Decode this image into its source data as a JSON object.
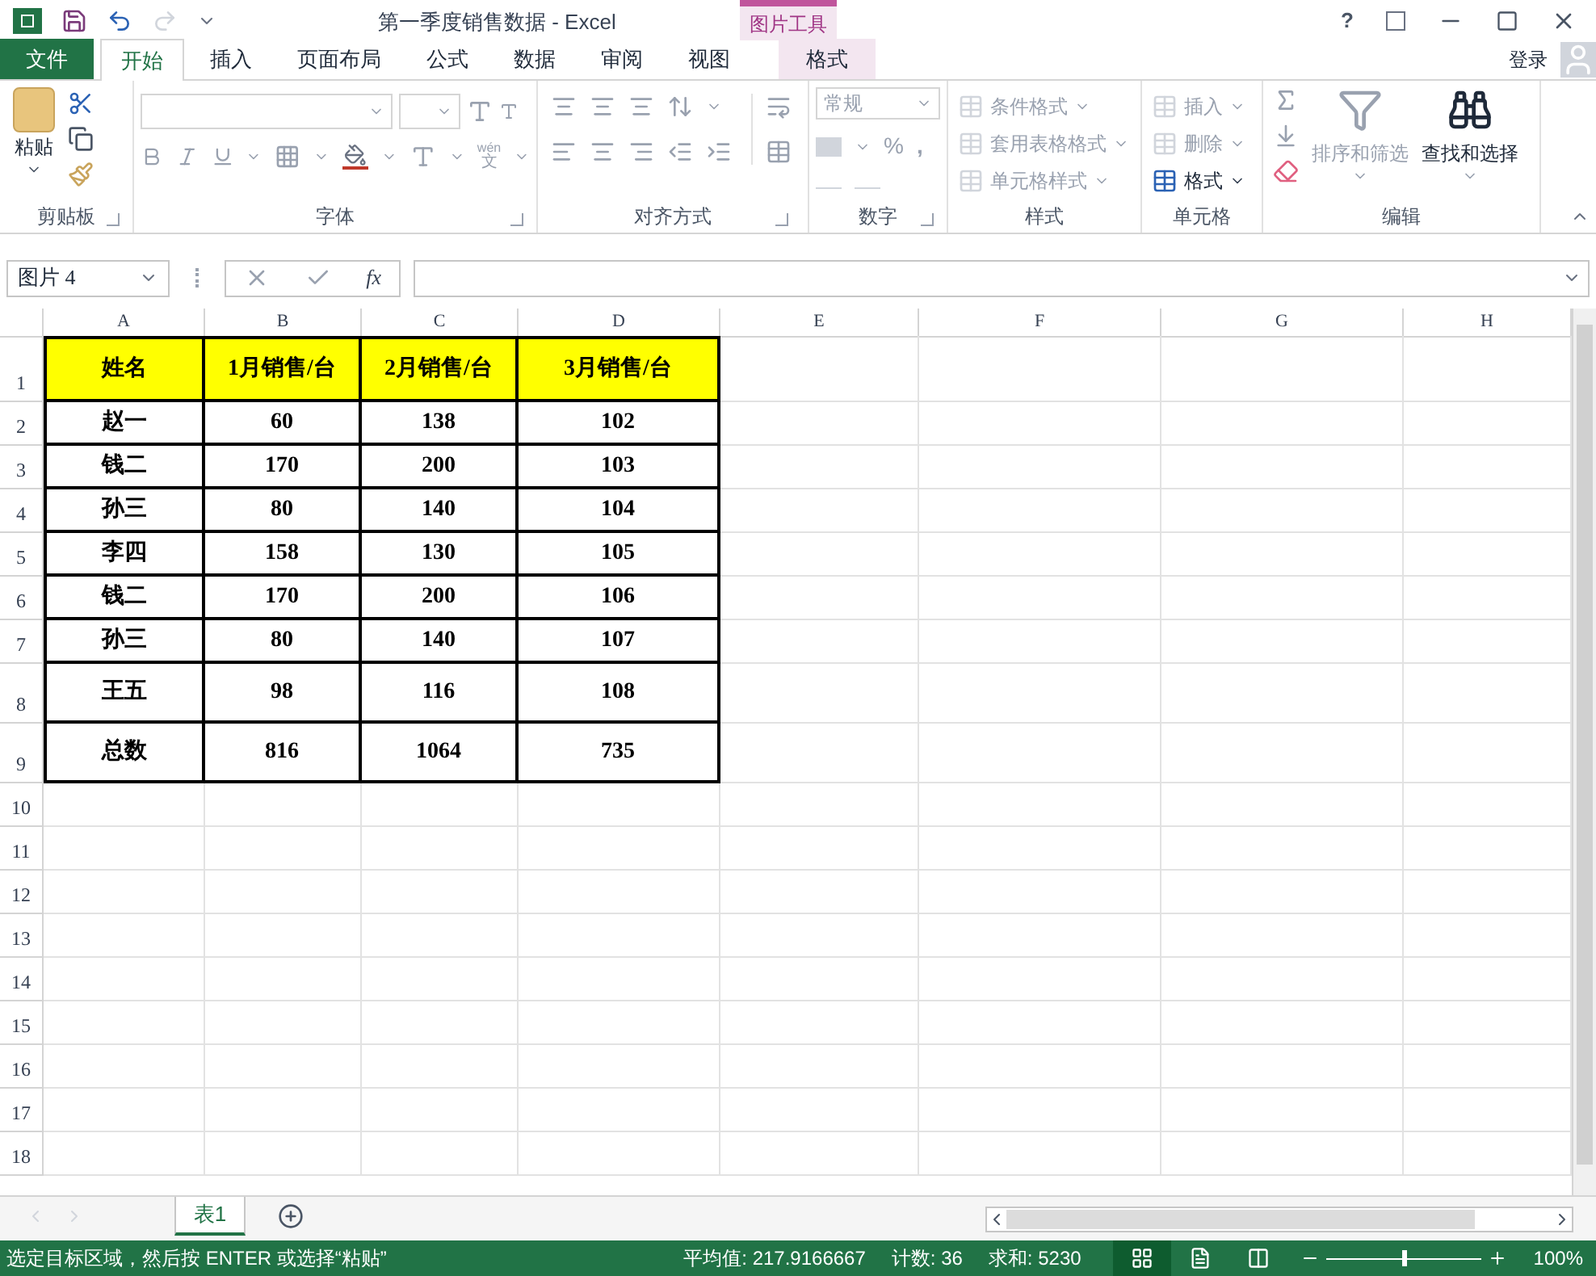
{
  "window": {
    "title": "第一季度销售数据 - Excel",
    "context_group": "图片工具",
    "help": "?",
    "account": "登录"
  },
  "ribbon_tabs": [
    {
      "label": "文件",
      "kind": "file",
      "selected": false
    },
    {
      "label": "开始",
      "kind": "normal",
      "selected": true
    },
    {
      "label": "插入",
      "kind": "normal",
      "selected": false
    },
    {
      "label": "页面布局",
      "kind": "normal",
      "selected": false
    },
    {
      "label": "公式",
      "kind": "normal",
      "selected": false
    },
    {
      "label": "数据",
      "kind": "normal",
      "selected": false
    },
    {
      "label": "审阅",
      "kind": "normal",
      "selected": false
    },
    {
      "label": "视图",
      "kind": "normal",
      "selected": false
    },
    {
      "label": "格式",
      "kind": "context",
      "selected": false
    }
  ],
  "ribbon": {
    "clipboard": {
      "paste": "粘贴",
      "label": "剪贴板"
    },
    "font": {
      "label": "字体",
      "phonetic_top": "wén",
      "phonetic_bottom": "文"
    },
    "alignment": {
      "label": "对齐方式"
    },
    "number": {
      "format": "常规",
      "percent": "%",
      "comma": ",",
      "label": "数字"
    },
    "styles": {
      "items": [
        {
          "label": "条件格式",
          "disabled": true
        },
        {
          "label": "套用表格格式",
          "disabled": true
        },
        {
          "label": "单元格样式",
          "disabled": true
        }
      ],
      "label": "样式"
    },
    "cells": {
      "items": [
        {
          "label": "插入",
          "disabled": true
        },
        {
          "label": "删除",
          "disabled": true
        },
        {
          "label": "格式",
          "disabled": false
        }
      ],
      "label": "单元格"
    },
    "editing": {
      "sort": {
        "label": "排序和筛选",
        "disabled": true
      },
      "find": {
        "label": "查找和选择",
        "disabled": false
      },
      "label": "编辑"
    }
  },
  "formula_bar": {
    "name_box": "图片 4",
    "fx": "fx"
  },
  "sheet": {
    "columns": [
      "A",
      "B",
      "C",
      "D",
      "E",
      "F",
      "G",
      "H"
    ],
    "rows": [
      {
        "number": "1",
        "kind": "header",
        "cells": [
          "姓名",
          "1月销售/台",
          "2月销售/台",
          "3月销售/台"
        ]
      },
      {
        "number": "2",
        "kind": "data",
        "cells": [
          "赵一",
          "60",
          "138",
          "102"
        ]
      },
      {
        "number": "3",
        "kind": "data",
        "cells": [
          "钱二",
          "170",
          "200",
          "103"
        ]
      },
      {
        "number": "4",
        "kind": "data",
        "cells": [
          "孙三",
          "80",
          "140",
          "104"
        ]
      },
      {
        "number": "5",
        "kind": "data",
        "cells": [
          "李四",
          "158",
          "130",
          "105"
        ]
      },
      {
        "number": "6",
        "kind": "data",
        "cells": [
          "钱二",
          "170",
          "200",
          "106"
        ]
      },
      {
        "number": "7",
        "kind": "data",
        "cells": [
          "孙三",
          "80",
          "140",
          "107"
        ]
      },
      {
        "number": "8",
        "kind": "data",
        "cells": [
          "王五",
          "98",
          "116",
          "108"
        ]
      },
      {
        "number": "9",
        "kind": "data",
        "cells": [
          "总数",
          "816",
          "1064",
          "735"
        ]
      },
      {
        "number": "10"
      },
      {
        "number": "11"
      },
      {
        "number": "12"
      },
      {
        "number": "13"
      },
      {
        "number": "14"
      },
      {
        "number": "15"
      },
      {
        "number": "16"
      },
      {
        "number": "17"
      },
      {
        "number": "18"
      }
    ]
  },
  "sheet_tabs": [
    {
      "label": "表1",
      "selected": true
    }
  ],
  "status_bar": {
    "message": "选定目标区域，然后按 ENTER 或选择“粘贴”",
    "average": "平均值: 217.9166667",
    "count": "计数: 36",
    "sum": "求和: 5230",
    "views": [
      {
        "kind": "normal",
        "selected": true
      },
      {
        "kind": "layout",
        "selected": false
      },
      {
        "kind": "pagebreak",
        "selected": false
      }
    ],
    "zoom": {
      "level": 0.5,
      "reading": "100%"
    }
  }
}
